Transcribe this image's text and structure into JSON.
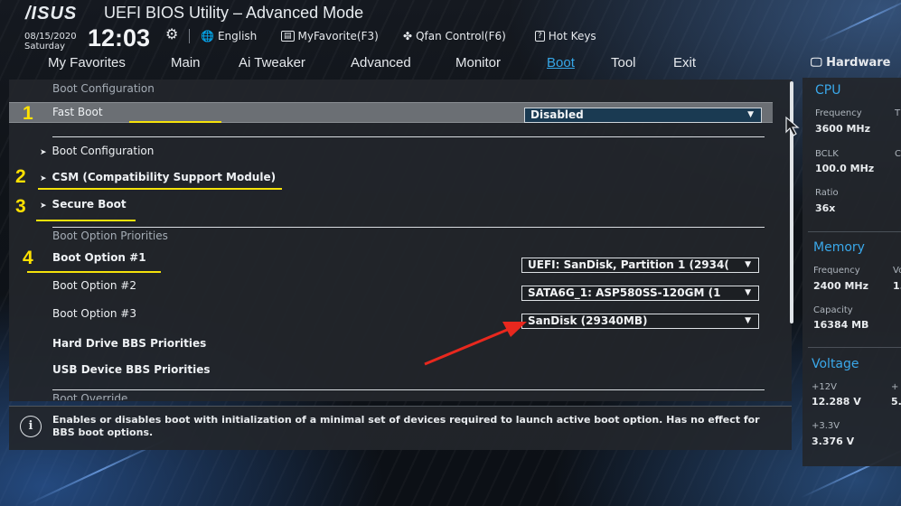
{
  "header": {
    "logo": "/ISUS",
    "title": "UEFI BIOS Utility – Advanced Mode",
    "date": "08/15/2020",
    "day": "Saturday",
    "time": "12:03",
    "items": [
      {
        "icon": "globe-icon",
        "label": "English"
      },
      {
        "icon": "favorites-icon",
        "label": "MyFavorite(F3)"
      },
      {
        "icon": "fan-icon",
        "label": "Qfan Control(F6)"
      },
      {
        "icon": "help-icon",
        "label": "Hot Keys"
      }
    ]
  },
  "tabs": [
    "My Favorites",
    "Main",
    "Ai Tweaker",
    "Advanced",
    "Monitor",
    "Boot",
    "Tool",
    "Exit"
  ],
  "active_tab": "Boot",
  "main": {
    "boot_configuration_label": "Boot Configuration",
    "fast_boot": {
      "label": "Fast Boot",
      "value": "Disabled"
    },
    "submenus": [
      "Boot Configuration",
      "CSM (Compatibility Support Module)",
      "Secure Boot"
    ],
    "priorities_label": "Boot Option Priorities",
    "boot_options": [
      {
        "label": "Boot Option #1",
        "value": "UEFI: SanDisk, Partition 1 (2934("
      },
      {
        "label": "Boot Option #2",
        "value": "SATA6G_1: ASP580SS-120GM (1"
      },
      {
        "label": "Boot Option #3",
        "value": "SanDisk  (29340MB)"
      }
    ],
    "hdd_bbs": "Hard Drive BBS Priorities",
    "usb_bbs": "USB Device BBS Priorities",
    "boot_override_label": "Boot Override"
  },
  "help": {
    "text": "Enables or disables boot with initialization of a minimal set of devices required to launch active boot option. Has no effect for BBS boot options."
  },
  "hardware": {
    "title": "Hardware",
    "cpu": {
      "title": "CPU",
      "frequency_label": "Frequency",
      "frequency": "3600 MHz",
      "temp_label": "T",
      "bclk_label": "BCLK",
      "bclk": "100.0 MHz",
      "core_label": "C",
      "ratio_label": "Ratio",
      "ratio": "36x"
    },
    "memory": {
      "title": "Memory",
      "frequency_label": "Frequency",
      "frequency": "2400 MHz",
      "voltage_label": "Vo",
      "voltage_partial": "1.",
      "capacity_label": "Capacity",
      "capacity": "16384 MB"
    },
    "voltage": {
      "title": "Voltage",
      "v12_label": "+12V",
      "v12": "12.288 V",
      "v5_label": "+",
      "v5_partial": "5.",
      "v33_label": "+3.3V",
      "v33": "3.376 V"
    }
  },
  "annotations": [
    "1",
    "2",
    "3",
    "4"
  ],
  "colors": {
    "accent": "#36a7e8",
    "annotation": "#ffe100",
    "arrow": "#e8281e"
  }
}
